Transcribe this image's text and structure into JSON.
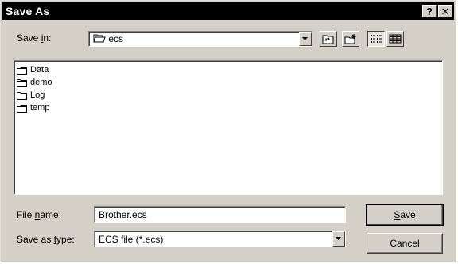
{
  "window": {
    "title": "Save As",
    "help_glyph": "?",
    "close_glyph": "✕"
  },
  "save_in": {
    "label_pre": "Save ",
    "label_key": "i",
    "label_post": "n:",
    "value": "ecs",
    "icon": "open-folder-icon"
  },
  "toolbar": {
    "buttons": [
      {
        "name": "up-one-level",
        "icon": "up-folder-icon"
      },
      {
        "name": "create-new-folder",
        "icon": "new-folder-icon"
      },
      {
        "name": "list-view",
        "icon": "list-view-icon",
        "pressed": true
      },
      {
        "name": "details-view",
        "icon": "details-view-icon"
      }
    ]
  },
  "files": [
    {
      "name": "Data",
      "icon": "folder-icon"
    },
    {
      "name": "demo",
      "icon": "folder-icon"
    },
    {
      "name": "Log",
      "icon": "folder-icon"
    },
    {
      "name": "temp",
      "icon": "folder-icon"
    }
  ],
  "file_name": {
    "label_pre": "File ",
    "label_key": "n",
    "label_post": "ame:",
    "value": "Brother.ecs"
  },
  "save_as_type": {
    "label_pre": "Save as ",
    "label_key": "t",
    "label_post": "ype:",
    "value": "ECS file (*.ecs)"
  },
  "buttons": {
    "save_key": "S",
    "save_rest": "ave",
    "cancel": "Cancel"
  },
  "colors": {
    "face": "#d4d0c8",
    "titlebar": "#000000",
    "shadow": "#808080"
  }
}
